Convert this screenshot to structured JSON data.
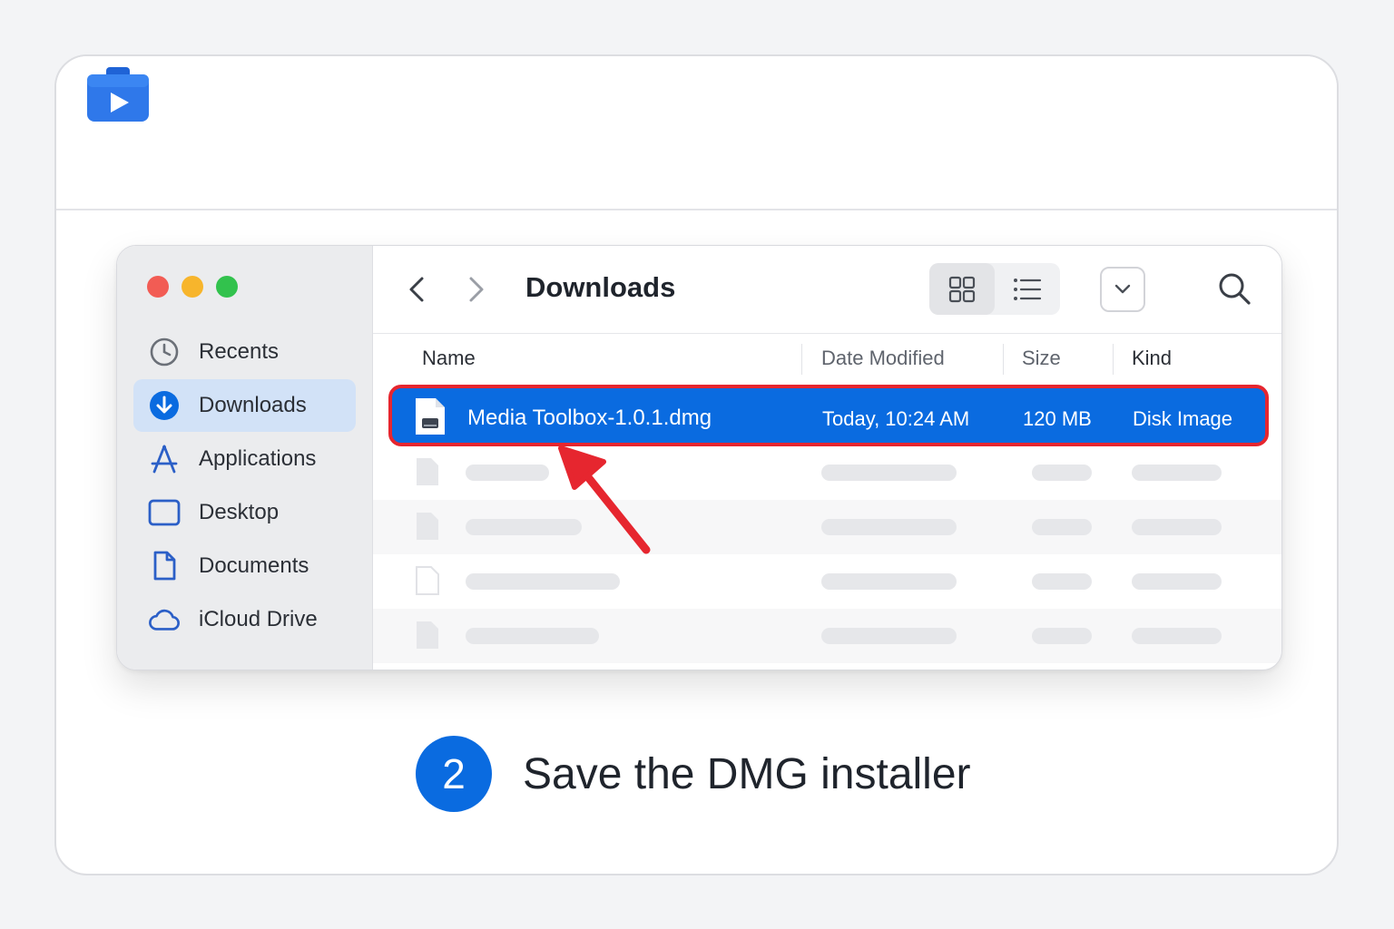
{
  "finder": {
    "title": "Downloads",
    "sidebar": {
      "items": [
        {
          "label": "Recents",
          "icon": "clock-icon"
        },
        {
          "label": "Downloads",
          "icon": "download-circle-icon",
          "active": true
        },
        {
          "label": "Applications",
          "icon": "applications-icon"
        },
        {
          "label": "Desktop",
          "icon": "desktop-icon"
        },
        {
          "label": "Documents",
          "icon": "document-icon"
        },
        {
          "label": "iCloud Drive",
          "icon": "cloud-icon"
        }
      ]
    },
    "columns": {
      "name": "Name",
      "date": "Date Modified",
      "size": "Size",
      "kind": "Kind"
    },
    "selected_file": {
      "name": "Media Toolbox-1.0.1.dmg",
      "date": "Today, 10:24 AM",
      "size": "120 MB",
      "kind": "Disk Image",
      "icon": "disk-image-icon"
    }
  },
  "step": {
    "number": "2",
    "text": "Save the DMG installer"
  },
  "colors": {
    "accent": "#0a6be0",
    "highlight_border": "#e6262f",
    "arrow": "#e6262f"
  }
}
